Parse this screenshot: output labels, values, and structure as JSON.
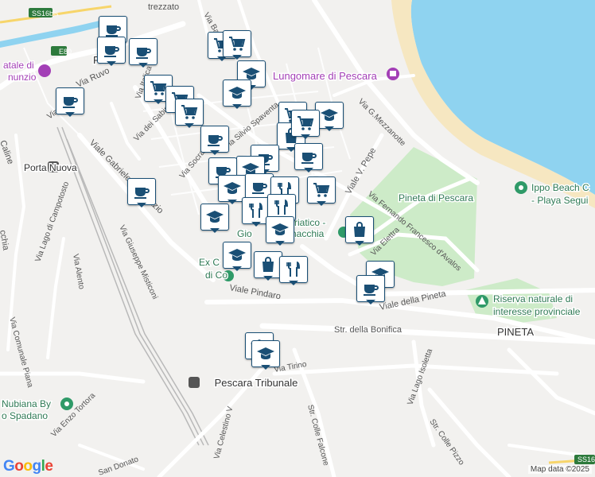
{
  "map": {
    "colors": {
      "water": "#8fd3f0",
      "beach": "#f6e7c1",
      "park": "#cdebc8",
      "road": "#ffffff",
      "rail": "#b9b9b9",
      "pin_border": "#1a4f75",
      "poi_purple": "#a33fb6",
      "poi_green": "#2f9a68"
    },
    "road_labels": [
      "SS16bis",
      "E80",
      "Via Trento",
      "Via Italica",
      "Via dei Sabini",
      "Via Socrate",
      "Via Silvio Spaventa",
      "Viale Gabriele d'Annunzio",
      "Via Giuseppe Misticoni",
      "Via Lago di Campotosto",
      "Via Alento",
      "Via Comunale Piana",
      "Via Enzo Tortora",
      "Via Tirino",
      "Via Celestino V",
      "Str. Colle Falcone",
      "Str. della Bonifica",
      "Viale Pindaro",
      "Viale della Pineta",
      "Via Elettra",
      "Via Fernando Francesco d'Avalos",
      "Viale V. Pepe",
      "Via G.Mezzanotte",
      "Via Lago Isoletta",
      "Str. Colle Pizzo",
      "Via Ruvo",
      "San Donato",
      "Via Bar",
      "trezzato",
      "Caline",
      "cchia",
      "SS16"
    ],
    "place_labels": [
      "Lungomare di Pescara",
      "Pineta di Pescara",
      "PINETA",
      "Pescara Tribunale",
      "Porta Nuova",
      "Ippo Beach C",
      "- Playa Segui",
      "Riserva naturale di",
      "interesse provinciale",
      "Nubiana By",
      "o Spadano",
      "riatico -",
      "Gio",
      "rnacchia",
      "Ex C",
      "di Co",
      "atale di",
      "nunzio",
      "Pesc"
    ],
    "pins": [
      {
        "icon": "coffee-icon"
      },
      {
        "icon": "coffee-icon"
      },
      {
        "icon": "coffee-icon"
      },
      {
        "icon": "cart-icon"
      },
      {
        "icon": "cart-icon"
      },
      {
        "icon": "graduation-cap-icon"
      },
      {
        "icon": "graduation-cap-icon"
      },
      {
        "icon": "coffee-icon"
      },
      {
        "icon": "cart-icon"
      },
      {
        "icon": "cart-icon"
      },
      {
        "icon": "cart-icon"
      },
      {
        "icon": "cart-icon"
      },
      {
        "icon": "graduation-cap-icon"
      },
      {
        "icon": "shopping-bag-icon"
      },
      {
        "icon": "cart-icon"
      },
      {
        "icon": "coffee-icon"
      },
      {
        "icon": "coffee-icon"
      },
      {
        "icon": "coffee-icon"
      },
      {
        "icon": "graduation-cap-icon"
      },
      {
        "icon": "coffee-icon"
      },
      {
        "icon": "graduation-cap-icon"
      },
      {
        "icon": "coffee-icon"
      },
      {
        "icon": "coffee-icon"
      },
      {
        "icon": "cutlery-icon"
      },
      {
        "icon": "cart-icon"
      },
      {
        "icon": "graduation-cap-icon"
      },
      {
        "icon": "cutlery-icon"
      },
      {
        "icon": "cutlery-icon"
      },
      {
        "icon": "graduation-cap-icon"
      },
      {
        "icon": "shopping-bag-icon"
      },
      {
        "icon": "graduation-cap-icon"
      },
      {
        "icon": "shopping-bag-icon"
      },
      {
        "icon": "cutlery-icon"
      },
      {
        "icon": "graduation-cap-icon"
      },
      {
        "icon": "coffee-icon"
      },
      {
        "icon": "graduation-cap-icon"
      },
      {
        "icon": "graduation-cap-icon"
      }
    ]
  },
  "attribution": {
    "logo": "Google",
    "credit": "Map data ©2025"
  }
}
